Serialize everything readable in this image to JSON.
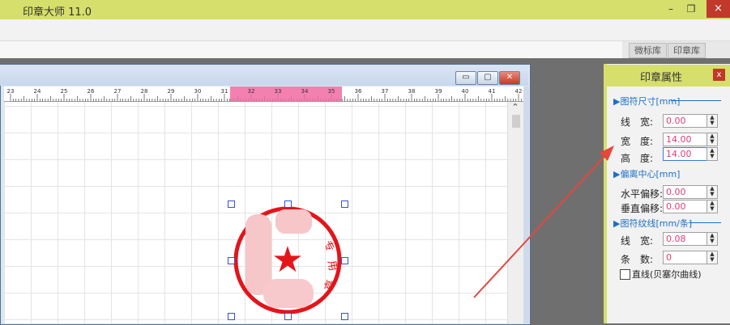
{
  "window": {
    "title": "印章大师 11.0",
    "minimize": "–",
    "restore": "❐",
    "close": "×"
  },
  "library_tabs": [
    "微标库",
    "印章库"
  ],
  "ruler": {
    "ticks": [
      "23",
      "24",
      "25",
      "26",
      "27",
      "28",
      "29",
      "30",
      "31",
      "32",
      "33",
      "34",
      "35",
      "36",
      "37",
      "38",
      "39",
      "40",
      "41",
      "42"
    ]
  },
  "document": {
    "minimize": "▭",
    "restore": "▢",
    "close": "✕"
  },
  "seal": {
    "text": "专用章",
    "color": "#e3151b",
    "star": "★"
  },
  "panel": {
    "title": "印章属性",
    "close": "x",
    "sections": {
      "size": "▶图符尺寸[mm]",
      "offset": "▶偏离中心[mm]",
      "lines": "▶图符纹线[mm/条]"
    },
    "fields": {
      "line_width": {
        "label": "线　宽:",
        "value": "0.00"
      },
      "width": {
        "label": "宽　度:",
        "value": "14.00"
      },
      "height": {
        "label": "高　度:",
        "value": "14.00"
      },
      "h_offset": {
        "label": "水平偏移:",
        "value": "0.00"
      },
      "v_offset": {
        "label": "垂直偏移:",
        "value": "0.00"
      },
      "stroke_width": {
        "label": "线　宽:",
        "value": "0.08"
      },
      "count": {
        "label": "条　数:",
        "value": "0"
      }
    },
    "checkbox": {
      "label": "直线(贝塞尔曲线)",
      "checked": false
    }
  }
}
